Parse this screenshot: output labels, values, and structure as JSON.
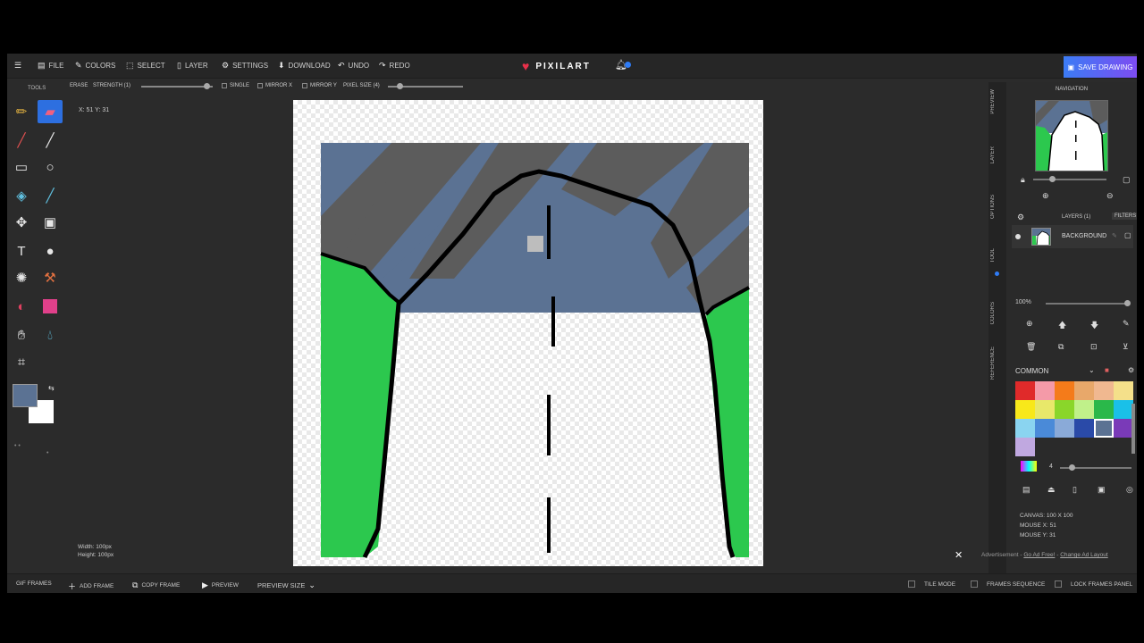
{
  "app": {
    "logo_text": "PIXILART",
    "save_button": "SAVE DRAWING"
  },
  "menu": {
    "file": "FILE",
    "colors": "COLORS",
    "select": "SELECT",
    "layer": "LAYER",
    "settings": "SETTINGS",
    "download": "DOWNLOAD",
    "undo": "UNDO",
    "redo": "REDO"
  },
  "options": {
    "tool_label": "ERASE",
    "strength_label": "STRENGTH (1)",
    "single_label": "SINGLE",
    "mirror_x_label": "MIRROR X",
    "mirror_y_label": "MIRROR Y",
    "pixel_size_label": "PIXEL SIZE (4)"
  },
  "tools": {
    "title": "TOOLS",
    "active": "eraser",
    "items": [
      "pencil",
      "eraser",
      "line-brush",
      "line",
      "rectangle",
      "ellipse",
      "bucket",
      "pen",
      "move",
      "select-rect",
      "text",
      "dither",
      "stamp",
      "smudge",
      "gradient",
      "fill-rect",
      "hand",
      "droplet",
      "crop"
    ]
  },
  "colors": {
    "primary": "#5b7293",
    "secondary": "#ffffff",
    "accent": "#2d6fe0"
  },
  "status": {
    "coord": "X: 51 Y: 31",
    "width": "Width: 100px",
    "height": "Height: 100px"
  },
  "navigation": {
    "title": "NAVIGATION"
  },
  "side_tabs": [
    "PREVIEW",
    "LAYER",
    "OPTIONS",
    "TOOL",
    "COLORS",
    "REFERENCE"
  ],
  "layers": {
    "label": "LAYERS (1)",
    "filters": "FILTERS",
    "items": [
      {
        "name": "BACKGROUND"
      }
    ],
    "opacity": "100%"
  },
  "palette": {
    "name": "COMMON",
    "swatches": [
      "#e02a2a",
      "#f49aa8",
      "#f47b1a",
      "#e8a86a",
      "#f0b890",
      "#f4e08a",
      "#f8e81a",
      "#e8e86a",
      "#8ad62a",
      "#c0f08a",
      "#2ab84a",
      "#1ac0e8",
      "#8ad4f0",
      "#4a8ad8",
      "#8aaad8",
      "#2a4aa8",
      "#5b7293",
      "#7a3ab8",
      "#c0a8e0"
    ],
    "selected_index": 16
  },
  "brush": {
    "size": "4"
  },
  "canvas_info": {
    "canvas": "CANVAS: 100 X 100",
    "mouse_x": "MOUSE X: 51",
    "mouse_y": "MOUSE Y: 31"
  },
  "bottom": {
    "gif_frames": "GIF FRAMES",
    "add_frame": "ADD FRAME",
    "copy_frame": "COPY FRAME",
    "preview": "PREVIEW",
    "preview_size": "PREVIEW SIZE",
    "tile_mode": "TILE MODE",
    "frames_sequence": "FRAMES SEQUENCE",
    "lock_frames_panel": "LOCK FRAMES PANEL"
  },
  "ad": {
    "label": "Advertisement -",
    "go_ad_free": "Go Ad Free!",
    "sep": "-",
    "change_ad_layout": "Change Ad Layout"
  }
}
